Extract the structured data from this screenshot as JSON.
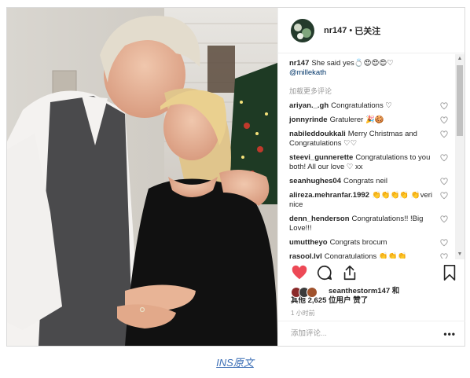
{
  "header": {
    "username": "nr147",
    "separator": "•",
    "follow_status": "已关注"
  },
  "caption": {
    "username": "nr147",
    "text": "She said yes💍😍😍😍♡",
    "mention": "@millekath"
  },
  "load_more": "加载更多评论",
  "comments": [
    {
      "user": "ariyan._.gh",
      "text": "Congratulations ♡"
    },
    {
      "user": "jonnyrinde",
      "text": "Gratulerer 🎉🍪"
    },
    {
      "user": "nabileddoukkali",
      "text": "Merry Christmas and Congratulations ♡♡"
    },
    {
      "user": "steevi_gunnerette",
      "text": "Congratulations to you both! All our love ♡ xx"
    },
    {
      "user": "seanhughes04",
      "text": "Congrats neil"
    },
    {
      "user": "alireza.mehranfar.1992",
      "text": "👏👏👏👏 👏veri nice"
    },
    {
      "user": "denn_henderson",
      "text": "Congratulations!! !Big Love!!!"
    },
    {
      "user": "umuttheyo",
      "text": "Congrats brocum"
    },
    {
      "user": "rasool.lvl",
      "text": "Congratulations 👏👏👏"
    }
  ],
  "likes": {
    "line1": "seanthestorm147 和",
    "line2": "其他 2,625 位用户 赞了"
  },
  "time_ago": "1 小时前",
  "add_comment_placeholder": "添加评论...",
  "more_glyph": "•••",
  "footer_link": "INS原文",
  "icons": [
    "heart-filled-icon",
    "comment-icon",
    "share-icon",
    "bookmark-icon",
    "heart-outline-icon",
    "more-icon"
  ],
  "colors": {
    "like_red": "#ed4956",
    "link_blue": "#3d6fb6",
    "mention_blue": "#003569"
  }
}
